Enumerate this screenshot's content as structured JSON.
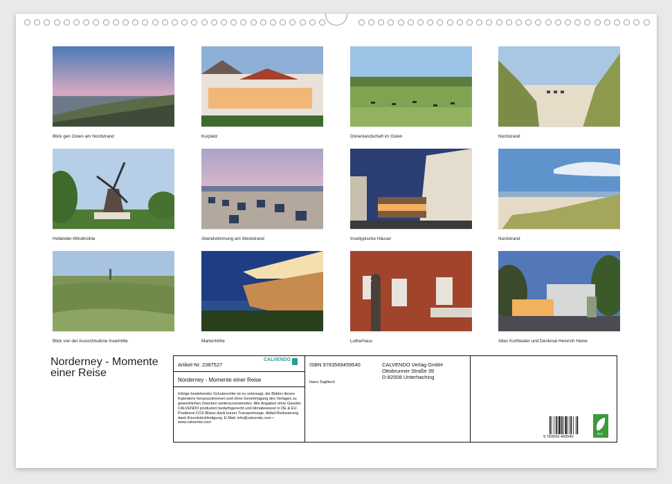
{
  "captions": [
    "Blick gen Osten am Nordstrand",
    "Kurplatz",
    "Dünenlandschaft im Osten",
    "Nordstrand",
    "Holländer-Windmühle",
    "Abendstimmung am Weststrand",
    "Inseltypische Häuser",
    "Nordstrand",
    "Blick von der Aussichtsdüne Inselmitte",
    "Marienhöhe",
    "Lutherhaus",
    "Altes Kurtheater und Denkmal Heinrich Heine"
  ],
  "title": "Norderney - Momente einer Reise",
  "article": "Artikel-Nr. 2387527",
  "calvendo": "CALVENDO",
  "subtitle_in_box": "Norderney - Momente einer Reise",
  "isbn": "ISBN 9783569459540",
  "author": "Hans Zaglitsch",
  "publisher_name": "CALVENDO Verlag GmbH",
  "publisher_street": "Ottobrunner Straße 39",
  "publisher_city": "D-82008 Unterhaching",
  "legal_text": "Infolge bestehender Schutzrechte ist es untersagt, die Blätter dieses Kalenders herauszutrennen und ohne Genehmigung des Verlages zu gewerblichen Zwecken weiterzuverwenden. Alle Angaben ohne Gewähr. CALVENDO produziert bedarfsgerecht und klimabewusst in DE & EU. Positivere CO2-Bilanz dank kurzer Transportwege. Abfall-Reduzierung dank Einzelstückfertigung. E-Mail: info@calvendo.com • www.calvendo.com",
  "barcode_number": "9 783569 459540",
  "eco_label": "eco",
  "colors": {
    "frame": "#111111",
    "eco_green": "#3b9a3b",
    "calvendo_teal": "#2a9d8f"
  }
}
